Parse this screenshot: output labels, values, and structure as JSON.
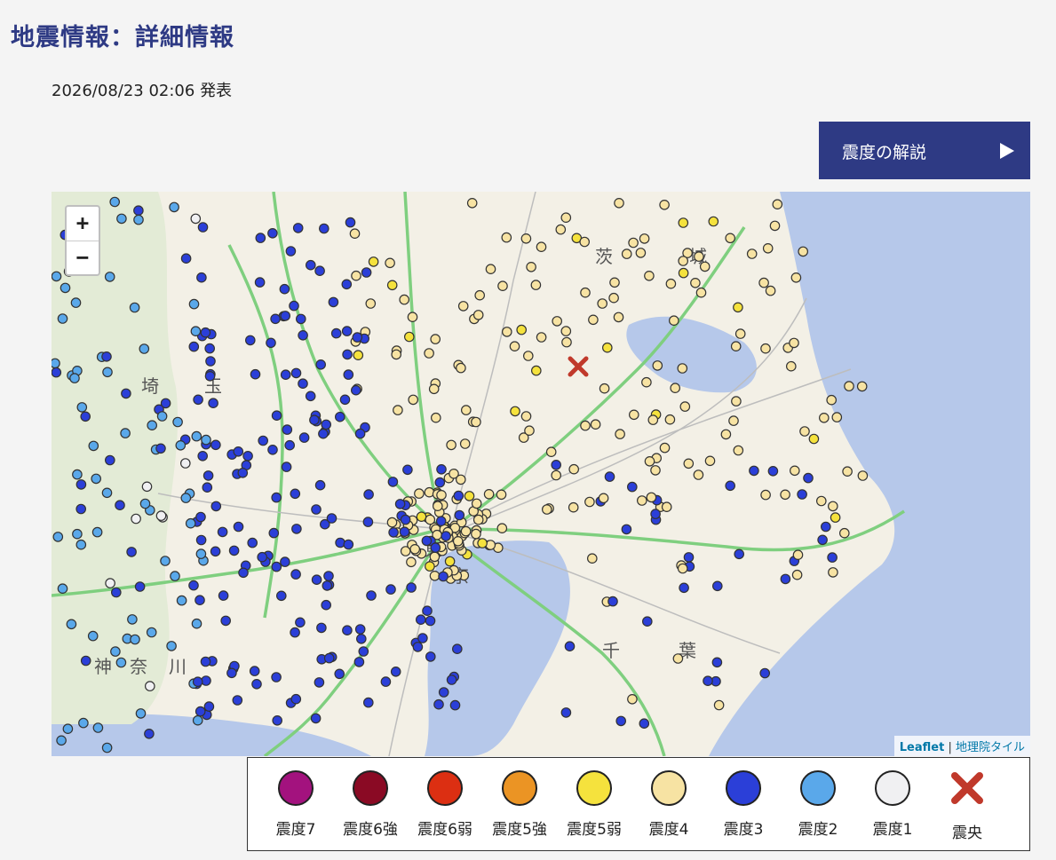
{
  "page": {
    "title": "地震情報：詳細情報",
    "announced": "2026/08/23 02:06 発表"
  },
  "explain_button": {
    "label": "震度の解説"
  },
  "map": {
    "zoom_in": "+",
    "zoom_out": "−",
    "attribution": {
      "leaflet": "Leaflet",
      "separator": "|",
      "tiles": "地理院タイル"
    },
    "place_labels": [
      "茨",
      "城",
      "玉",
      "埼",
      "神",
      "奈",
      "川",
      "千",
      "葉",
      "東",
      "京"
    ],
    "station_colors": {
      "shindo4": "#f7e3a3",
      "shindo5_weak": "#f5e23d",
      "shindo3": "#2b3fd8",
      "shindo2": "#5aa8ea",
      "shindo1": "#f0f0f2"
    },
    "epicenter_color": "#c0392b"
  },
  "legend": {
    "items": [
      {
        "label": "震度7",
        "color": "#a3127e"
      },
      {
        "label": "震度6強",
        "color": "#8a0a24"
      },
      {
        "label": "震度6弱",
        "color": "#dc2f12"
      },
      {
        "label": "震度5強",
        "color": "#eb9424"
      },
      {
        "label": "震度5弱",
        "color": "#f5e23d"
      },
      {
        "label": "震度4",
        "color": "#f7e3a3"
      },
      {
        "label": "震度3",
        "color": "#2b3fd8"
      },
      {
        "label": "震度2",
        "color": "#5aa8ea"
      },
      {
        "label": "震度1",
        "color": "#f0f0f2"
      }
    ],
    "epicenter_label": "震央"
  }
}
